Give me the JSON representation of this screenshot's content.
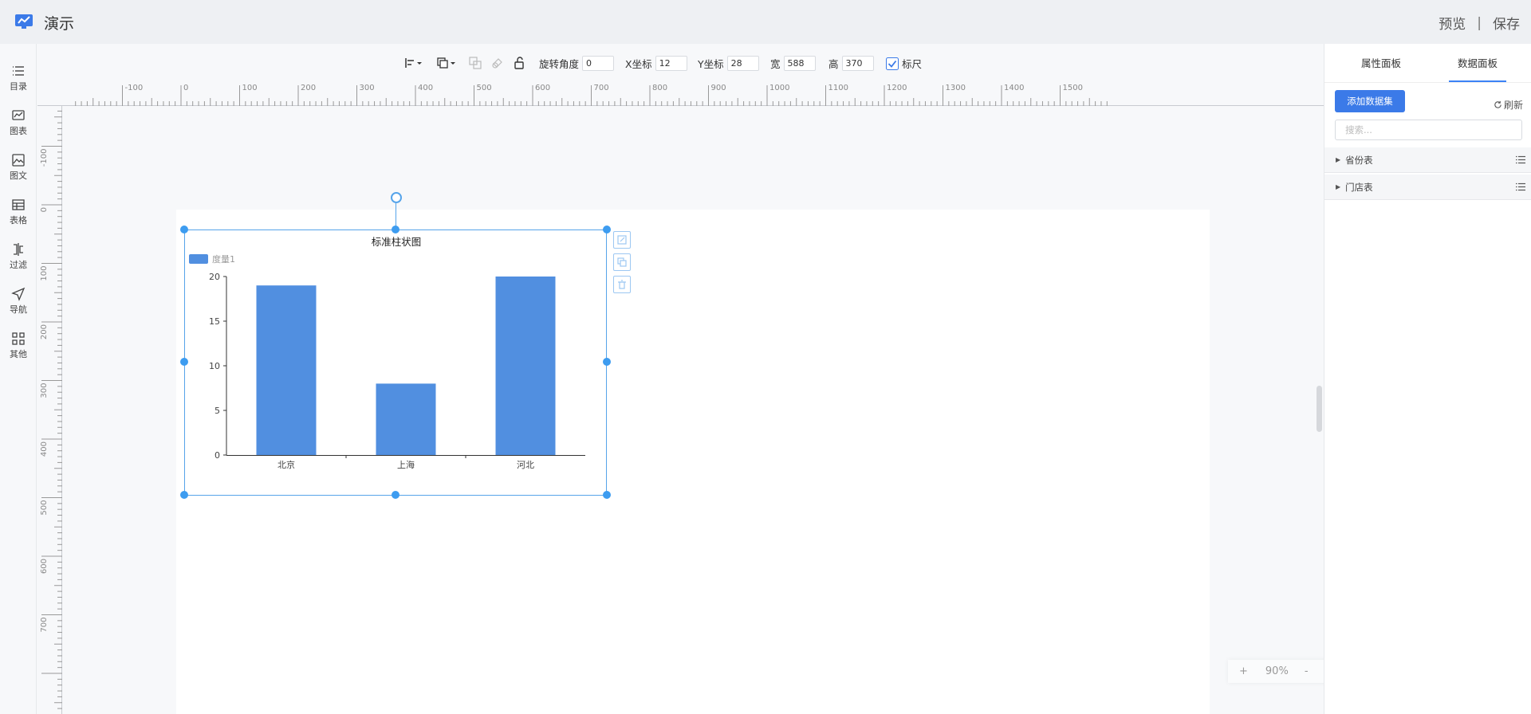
{
  "header": {
    "title": "演示",
    "preview_label": "预览",
    "separator": "|",
    "save_label": "保存"
  },
  "sidebar": {
    "items": [
      {
        "label": "目录",
        "icon": "list-icon"
      },
      {
        "label": "图表",
        "icon": "chart-icon"
      },
      {
        "label": "图文",
        "icon": "image-text-icon"
      },
      {
        "label": "表格",
        "icon": "table-icon"
      },
      {
        "label": "过滤",
        "icon": "filter-icon"
      },
      {
        "label": "导航",
        "icon": "navigation-icon"
      },
      {
        "label": "其他",
        "icon": "grid-icon"
      }
    ]
  },
  "toolbar": {
    "rotation_label": "旋转角度",
    "rotation_value": "0",
    "x_label": "X坐标",
    "x_value": "12",
    "y_label": "Y坐标",
    "y_value": "28",
    "width_label": "宽",
    "width_value": "588",
    "height_label": "高",
    "height_value": "370",
    "ruler_label": "标尺",
    "ruler_checked": true
  },
  "ruler": {
    "h_labels": [
      "-100",
      "0",
      "100",
      "200",
      "300",
      "400",
      "500",
      "600",
      "700",
      "800",
      "900",
      "1000",
      "1100",
      "1200",
      "1300",
      "1400",
      "1500"
    ],
    "v_labels": [
      "-100",
      "0",
      "100",
      "200",
      "300",
      "400",
      "500",
      "600",
      "700"
    ]
  },
  "chart_data": {
    "type": "bar",
    "title": "标准柱状图",
    "categories": [
      "北京",
      "上海",
      "河北"
    ],
    "series": [
      {
        "name": "度量1",
        "values": [
          19,
          8,
          20
        ]
      }
    ],
    "ylim": [
      0,
      20
    ],
    "yticks": [
      "0",
      "5",
      "10",
      "15",
      "20"
    ],
    "color": "#518fe0",
    "legend": "top-left",
    "grid": false
  },
  "right_panel": {
    "tabs": [
      {
        "label": "属性面板"
      },
      {
        "label": "数据面板"
      }
    ],
    "active_tab": 1,
    "add_dataset_label": "添加数据集",
    "refresh_label": "刷新",
    "search_placeholder": "搜索...",
    "datasets": [
      {
        "label": "省份表"
      },
      {
        "label": "门店表"
      }
    ]
  },
  "zoom": {
    "plus": "+",
    "level": "90%",
    "minus": "-"
  },
  "colors": {
    "accent": "#3b7ae8",
    "selection": "#3d9cf0",
    "bar": "#518fe0"
  }
}
